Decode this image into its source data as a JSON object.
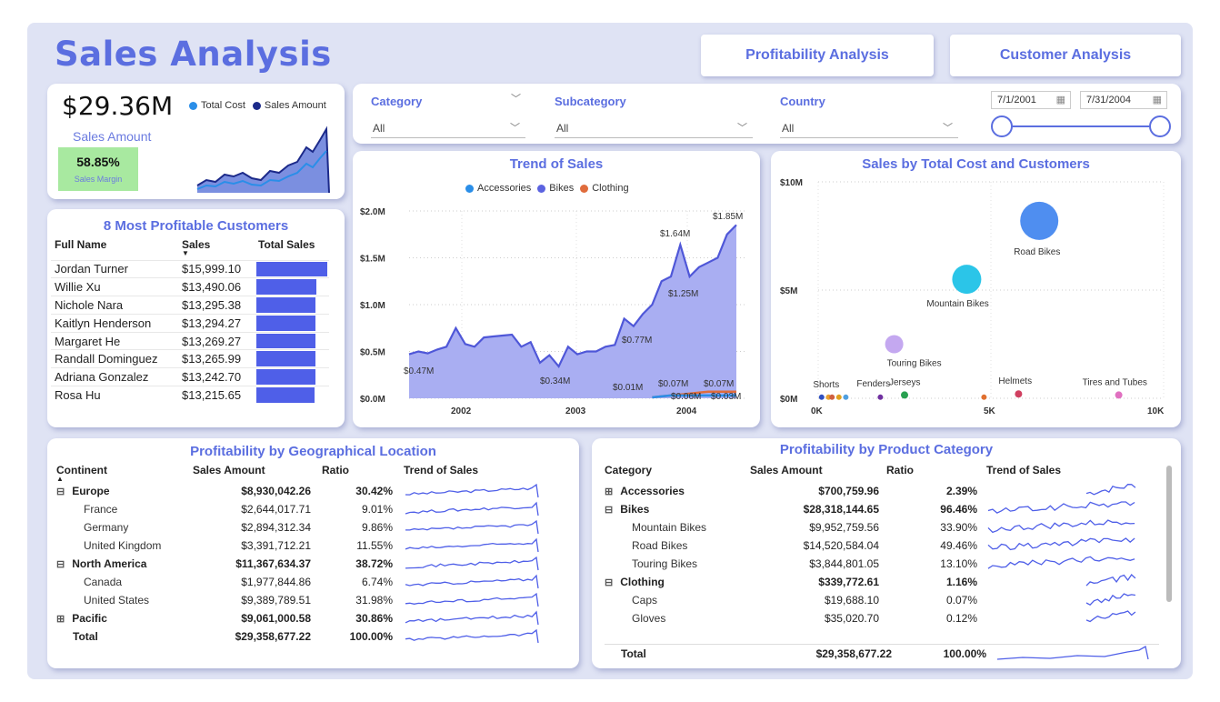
{
  "header": {
    "title": "Sales Analysis",
    "nav1": "Profitability Analysis",
    "nav2": "Customer Analysis"
  },
  "kpi": {
    "value": "$29.36M",
    "label": "Sales Amount",
    "margin_value": "58.85%",
    "margin_label": "Sales Margin",
    "legend": [
      "Total Cost",
      "Sales Amount"
    ],
    "legend_colors": [
      "#2a8ee8",
      "#1c2a8a"
    ]
  },
  "filters": {
    "category_label": "Category",
    "category_value": "All",
    "subcategory_label": "Subcategory",
    "subcategory_value": "All",
    "country_label": "Country",
    "country_value": "All",
    "date_start": "7/1/2001",
    "date_end": "7/31/2004"
  },
  "customers": {
    "title": "8 Most Profitable Customers",
    "headers": [
      "Full Name",
      "Sales",
      "Total Sales"
    ],
    "rows": [
      {
        "name": "Jordan Turner",
        "sales": "$15,999.10",
        "value": 15999.1
      },
      {
        "name": "Willie Xu",
        "sales": "$13,490.06",
        "value": 13490.06
      },
      {
        "name": "Nichole Nara",
        "sales": "$13,295.38",
        "value": 13295.38
      },
      {
        "name": "Kaitlyn Henderson",
        "sales": "$13,294.27",
        "value": 13294.27
      },
      {
        "name": "Margaret He",
        "sales": "$13,269.27",
        "value": 13269.27
      },
      {
        "name": "Randall Dominguez",
        "sales": "$13,265.99",
        "value": 13265.99
      },
      {
        "name": "Adriana Gonzalez",
        "sales": "$13,242.70",
        "value": 13242.7
      },
      {
        "name": "Rosa Hu",
        "sales": "$13,215.65",
        "value": 13215.65
      }
    ]
  },
  "chart_data": [
    {
      "type": "area",
      "title": "Trend of Sales",
      "legend": [
        "Accessories",
        "Bikes",
        "Clothing"
      ],
      "legend_colors": [
        "#2a8ee8",
        "#5b63e0",
        "#e06c3c"
      ],
      "y_ticks": [
        "$0.0M",
        "$0.5M",
        "$1.0M",
        "$1.5M",
        "$2.0M"
      ],
      "x_ticks": [
        "2002",
        "2003",
        "2004"
      ],
      "ylim": [
        0,
        2.0
      ],
      "series": [
        {
          "name": "Bikes",
          "values": [
            0.47,
            0.5,
            0.48,
            0.52,
            0.55,
            0.75,
            0.58,
            0.55,
            0.65,
            0.66,
            0.67,
            0.68,
            0.55,
            0.6,
            0.38,
            0.46,
            0.34,
            0.55,
            0.47,
            0.5,
            0.5,
            0.55,
            0.57,
            0.85,
            0.77,
            0.9,
            1.0,
            1.25,
            1.3,
            1.64,
            1.3,
            1.4,
            1.45,
            1.5,
            1.75,
            1.85
          ]
        },
        {
          "name": "Accessories",
          "values": [
            0.01,
            0.02,
            0.03,
            0.04,
            0.05,
            0.06,
            0.07,
            0.07,
            0.07,
            0.07
          ]
        },
        {
          "name": "Clothing",
          "values": [
            0.01,
            0.02,
            0.03,
            0.03,
            0.03,
            0.03,
            0.03,
            0.03,
            0.03,
            0.03
          ]
        }
      ],
      "data_labels": [
        "$1.85M",
        "$1.64M",
        "$1.25M",
        "$0.77M",
        "$0.47M",
        "$0.34M",
        "$0.01M",
        "$0.07M",
        "$0.07M",
        "$0.06M",
        "$0.03M"
      ]
    },
    {
      "type": "scatter",
      "title": "Sales by Total Cost and Customers",
      "y_ticks": [
        "$0M",
        "$5M",
        "$10M"
      ],
      "x_ticks": [
        "0K",
        "5K",
        "10K"
      ],
      "xlim": [
        0,
        10000
      ],
      "ylim": [
        0,
        10
      ],
      "points": [
        {
          "label": "Road Bikes",
          "x": 6400,
          "y": 8.2,
          "size": 21,
          "color": "#4f8ef0"
        },
        {
          "label": "Mountain Bikes",
          "x": 4300,
          "y": 5.5,
          "size": 16,
          "color": "#2bc5e8"
        },
        {
          "label": "Touring Bikes",
          "x": 2200,
          "y": 2.5,
          "size": 10,
          "color": "#c4a8f0"
        },
        {
          "label": "Shorts",
          "x": 300,
          "y": 0.05,
          "size": 3,
          "color": "#e8a030"
        },
        {
          "label": "Fenders",
          "x": 1800,
          "y": 0.05,
          "size": 3,
          "color": "#7030a0"
        },
        {
          "label": "Jerseys",
          "x": 2500,
          "y": 0.15,
          "size": 4,
          "color": "#28a050"
        },
        {
          "label": "Helmets",
          "x": 5800,
          "y": 0.2,
          "size": 4,
          "color": "#d04060"
        },
        {
          "label": "Tires and Tubes",
          "x": 8700,
          "y": 0.15,
          "size": 4,
          "color": "#e070c0"
        },
        {
          "label": "",
          "x": 100,
          "y": 0.05,
          "size": 3,
          "color": "#3050c0"
        },
        {
          "label": "",
          "x": 400,
          "y": 0.05,
          "size": 3,
          "color": "#d06040"
        },
        {
          "label": "",
          "x": 600,
          "y": 0.05,
          "size": 3,
          "color": "#e0a020"
        },
        {
          "label": "",
          "x": 800,
          "y": 0.05,
          "size": 3,
          "color": "#50a0e0"
        },
        {
          "label": "",
          "x": 4800,
          "y": 0.05,
          "size": 3,
          "color": "#e07030"
        }
      ]
    }
  ],
  "geo": {
    "title": "Profitability by Geographical Location",
    "headers": [
      "Continent",
      "Sales Amount",
      "Ratio",
      "Trend of Sales"
    ],
    "rows": [
      {
        "name": "Europe",
        "amount": "$8,930,042.26",
        "ratio": "30.42%",
        "level": 0,
        "exp": "⊟"
      },
      {
        "name": "France",
        "amount": "$2,644,017.71",
        "ratio": "9.01%",
        "level": 1,
        "exp": ""
      },
      {
        "name": "Germany",
        "amount": "$2,894,312.34",
        "ratio": "9.86%",
        "level": 1,
        "exp": ""
      },
      {
        "name": "United Kingdom",
        "amount": "$3,391,712.21",
        "ratio": "11.55%",
        "level": 1,
        "exp": ""
      },
      {
        "name": "North America",
        "amount": "$11,367,634.37",
        "ratio": "38.72%",
        "level": 0,
        "exp": "⊟"
      },
      {
        "name": "Canada",
        "amount": "$1,977,844.86",
        "ratio": "6.74%",
        "level": 1,
        "exp": ""
      },
      {
        "name": "United States",
        "amount": "$9,389,789.51",
        "ratio": "31.98%",
        "level": 1,
        "exp": ""
      },
      {
        "name": "Pacific",
        "amount": "$9,061,000.58",
        "ratio": "30.86%",
        "level": 0,
        "exp": "⊞"
      },
      {
        "name": "Total",
        "amount": "$29,358,677.22",
        "ratio": "100.00%",
        "level": 0,
        "exp": ""
      }
    ]
  },
  "product": {
    "title": "Profitability by Product Category",
    "headers": [
      "Category",
      "Sales Amount",
      "Ratio",
      "Trend of Sales"
    ],
    "rows": [
      {
        "name": "Accessories",
        "amount": "$700,759.96",
        "ratio": "2.39%",
        "level": 0,
        "exp": "⊞"
      },
      {
        "name": "Bikes",
        "amount": "$28,318,144.65",
        "ratio": "96.46%",
        "level": 0,
        "exp": "⊟"
      },
      {
        "name": "Mountain Bikes",
        "amount": "$9,952,759.56",
        "ratio": "33.90%",
        "level": 1,
        "exp": ""
      },
      {
        "name": "Road Bikes",
        "amount": "$14,520,584.04",
        "ratio": "49.46%",
        "level": 1,
        "exp": ""
      },
      {
        "name": "Touring Bikes",
        "amount": "$3,844,801.05",
        "ratio": "13.10%",
        "level": 1,
        "exp": ""
      },
      {
        "name": "Clothing",
        "amount": "$339,772.61",
        "ratio": "1.16%",
        "level": 0,
        "exp": "⊟"
      },
      {
        "name": "Caps",
        "amount": "$19,688.10",
        "ratio": "0.07%",
        "level": 1,
        "exp": ""
      },
      {
        "name": "Gloves",
        "amount": "$35,020.70",
        "ratio": "0.12%",
        "level": 1,
        "exp": ""
      }
    ],
    "total": {
      "name": "Total",
      "amount": "$29,358,677.22",
      "ratio": "100.00%"
    }
  }
}
